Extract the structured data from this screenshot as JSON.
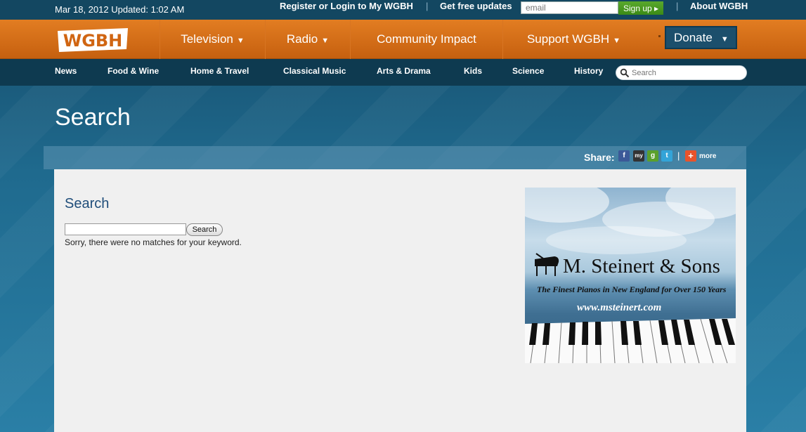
{
  "utility": {
    "date": "Mar 18, 2012 Updated: 1:02 AM",
    "register": "Register or Login to My WGBH",
    "separator": "|",
    "updates": "Get free updates",
    "email_placeholder": "email",
    "signup": "Sign up ▸",
    "about": "About WGBH"
  },
  "logo_text": "WGBH",
  "mainnav": {
    "items": [
      {
        "label": "Television",
        "caret": "▼"
      },
      {
        "label": "Radio",
        "caret": "▼"
      },
      {
        "label": "Community Impact",
        "caret": ""
      },
      {
        "label": "Support WGBH",
        "caret": "▼"
      }
    ],
    "donate": "Donate",
    "donate_caret": "▼"
  },
  "subnav": {
    "items": [
      "News",
      "Food & Wine",
      "Home & Travel",
      "Classical Music",
      "Arts & Drama",
      "Kids",
      "Science",
      "History"
    ],
    "search_placeholder": "Search"
  },
  "page_title": "Search",
  "share": {
    "label": "Share:",
    "separator": "|",
    "more": "more",
    "icons": [
      {
        "name": "facebook",
        "glyph": "f",
        "color": "#3b5998"
      },
      {
        "name": "myspace",
        "glyph": "my",
        "color": "#333333"
      },
      {
        "name": "google",
        "glyph": "g",
        "color": "#5aa02c"
      },
      {
        "name": "twitter",
        "glyph": "t",
        "color": "#33a4d8"
      }
    ],
    "plus_color": "#e8532b"
  },
  "content": {
    "heading": "Search",
    "search_value": "",
    "search_button": "Search",
    "no_match": "Sorry, there were no matches for your keyword."
  },
  "ad": {
    "brand": "M. Steinert & Sons",
    "tagline": "The Finest Pianos in New England for Over 150 Years",
    "url": "www.msteinert.com"
  },
  "colors": {
    "orange": "#d96c18",
    "navy": "#0e3a50",
    "accent_blue": "#1f4d7a"
  }
}
